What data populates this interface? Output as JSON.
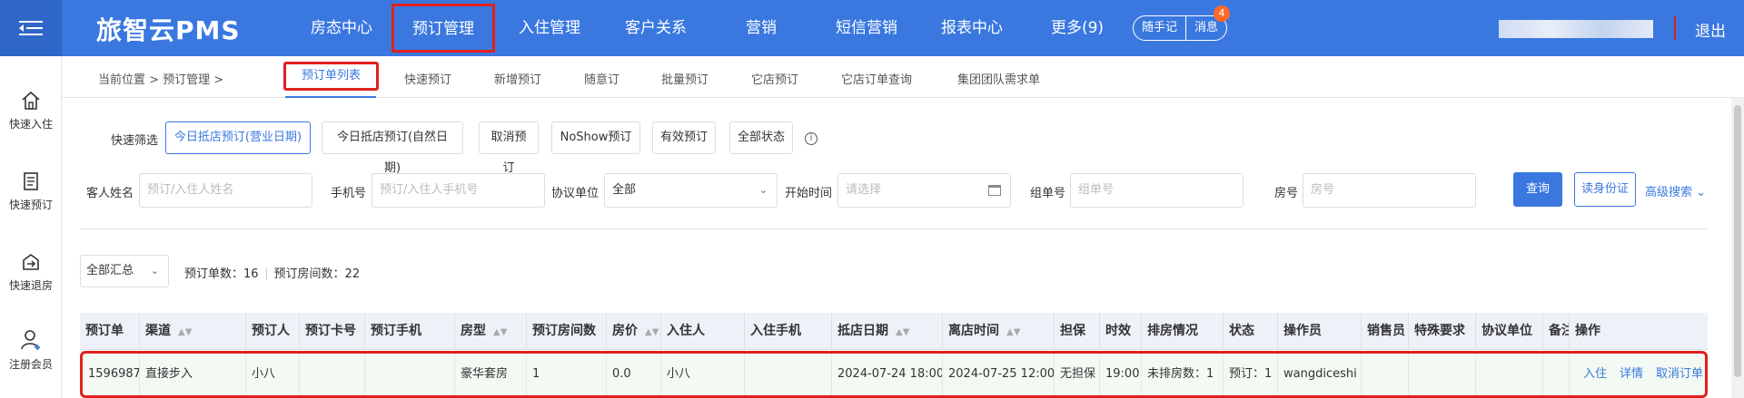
{
  "app": {
    "brand": "旅智云PMS"
  },
  "top_nav": [
    {
      "label": "房态中心"
    },
    {
      "label": "预订管理"
    },
    {
      "label": "入住管理"
    },
    {
      "label": "客户关系"
    },
    {
      "label": "营销"
    },
    {
      "label": "短信营销"
    },
    {
      "label": "报表中心"
    },
    {
      "label": "更多(9)"
    }
  ],
  "header_right": {
    "notes": "随手记",
    "messages": "消息",
    "message_count": "4",
    "logout": "退出"
  },
  "sidebar": [
    {
      "label": "快速入住",
      "icon": "home-icon"
    },
    {
      "label": "快速预订",
      "icon": "document-icon"
    },
    {
      "label": "快速退房",
      "icon": "checkout-icon"
    },
    {
      "label": "注册会员",
      "icon": "add-user-icon"
    }
  ],
  "breadcrumb": "当前位置 > 预订管理 >",
  "sub_nav": [
    {
      "label": "预订单列表"
    },
    {
      "label": "快速预订"
    },
    {
      "label": "新增预订"
    },
    {
      "label": "随意订"
    },
    {
      "label": "批量预订"
    },
    {
      "label": "它店预订"
    },
    {
      "label": "它店订单查询"
    },
    {
      "label": "集团团队需求单"
    }
  ],
  "quick_filter": {
    "label": "快速筛选",
    "buttons": [
      "今日抵店预订(营业日期)",
      "今日抵店预订(自然日期)",
      "取消预订",
      "NoShow预订",
      "有效预订",
      "全部状态"
    ],
    "info_icon": "i"
  },
  "search": {
    "guest_label": "客人姓名",
    "guest_placeholder": "预订/入住人姓名",
    "phone_label": "手机号",
    "phone_placeholder": "预订/入住人手机号",
    "agreement_label": "协议单位",
    "agreement_value": "全部",
    "start_label": "开始时间",
    "start_placeholder": "请选择",
    "group_label": "组单号",
    "group_placeholder": "组单号",
    "room_label": "房号",
    "room_placeholder": "房号",
    "query_button": "查询",
    "id_button": "读身份证",
    "advanced": "高级搜索"
  },
  "summary": {
    "select_value": "全部汇总",
    "order_count_text": "预订单数：16",
    "room_count_text": "预订房间数：22"
  },
  "table": {
    "columns": [
      "预订单",
      "渠道",
      "预订人",
      "预订卡号",
      "预订手机",
      "房型",
      "预订房间数",
      "房价",
      "入住人",
      "入住手机",
      "抵店日期",
      "离店时间",
      "担保",
      "时效",
      "排房情况",
      "状态",
      "操作员",
      "销售员",
      "特殊要求",
      "协议单位",
      "备注",
      "操作"
    ],
    "rows": [
      {
        "cells": [
          "1596987",
          "直接步入",
          "小八",
          "",
          "",
          "豪华套房",
          "1",
          "0.0",
          "小八",
          "",
          "2024-07-24 18:00",
          "2024-07-25 12:00",
          "无担保",
          "19:00",
          "未排房数：1",
          "预订：1",
          "wangdiceshi",
          "",
          "",
          "",
          ""
        ],
        "actions": [
          "入住",
          "详情",
          "取消订单"
        ]
      }
    ]
  },
  "colors": {
    "primary": "#3a78e0",
    "highlight": "#e0201f",
    "row_bg": "#f3f9f3"
  }
}
